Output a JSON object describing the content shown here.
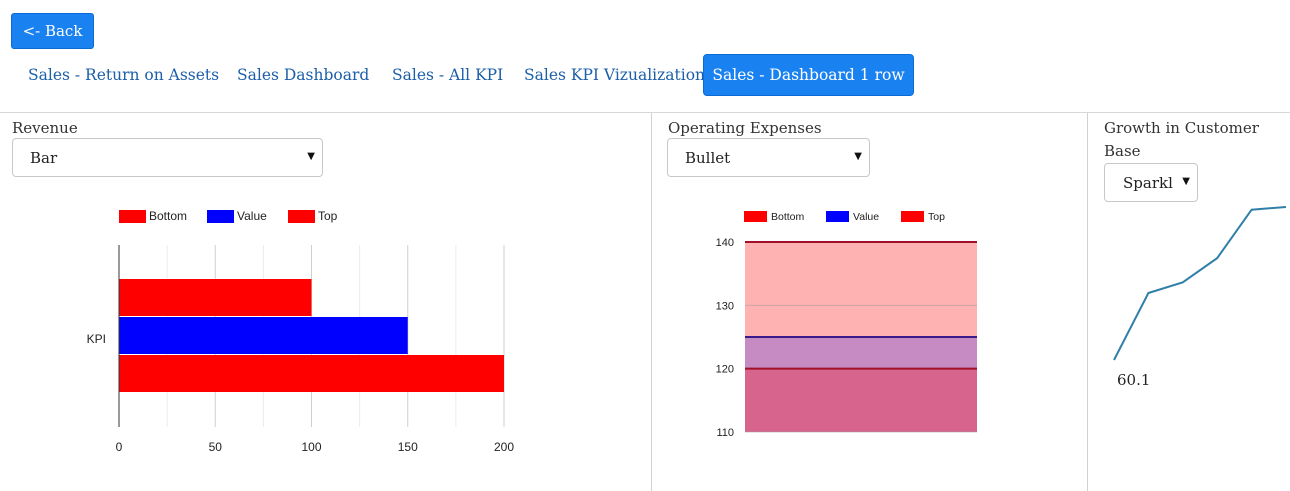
{
  "back_button": {
    "label": "<- Back"
  },
  "tabs": [
    {
      "label": "Sales - Return on Assets",
      "active": false
    },
    {
      "label": "Sales Dashboard",
      "active": false
    },
    {
      "label": "Sales - All KPI",
      "active": false
    },
    {
      "label": "Sales KPI Vizualization",
      "active": false
    },
    {
      "label": "Sales - Dashboard 1 row",
      "active": true
    }
  ],
  "panels": {
    "revenue": {
      "title": "Revenue",
      "select_value": "Bar"
    },
    "operating_expenses": {
      "title": "Operating Expenses",
      "select_value": "Bullet"
    },
    "growth": {
      "title_line1": "Growth in Customer",
      "title_line2": "Base",
      "select_value": "Sparkl",
      "value_label": "60.1"
    }
  },
  "colors": {
    "accent": "#1a82f0",
    "link": "#1c5fa8",
    "bottom": "#ff0000",
    "value": "#0000ff",
    "top": "#ff0000",
    "sparkline": "#2f7fa8"
  },
  "icons": {
    "caret": "caret-down-icon"
  },
  "chart_data": [
    {
      "type": "bar",
      "orientation": "horizontal",
      "categories": [
        "KPI"
      ],
      "series": [
        {
          "name": "Bottom",
          "values": [
            100
          ],
          "color": "#ff0000"
        },
        {
          "name": "Value",
          "values": [
            150
          ],
          "color": "#0000ff"
        },
        {
          "name": "Top",
          "values": [
            200
          ],
          "color": "#ff0000"
        }
      ],
      "xlim": [
        0,
        200
      ],
      "xticks": [
        0,
        50,
        100,
        150,
        200
      ],
      "grid": true,
      "legend": "top"
    },
    {
      "type": "bar",
      "subtype": "bullet",
      "categories": [
        ""
      ],
      "series": [
        {
          "name": "Bottom",
          "values": [
            120
          ],
          "color": "#ff0000"
        },
        {
          "name": "Value",
          "values": [
            125
          ],
          "color": "#0000ff"
        },
        {
          "name": "Top",
          "values": [
            140
          ],
          "color": "#ff0000"
        }
      ],
      "ylim": [
        110,
        140
      ],
      "yticks": [
        110,
        120,
        130,
        140
      ],
      "grid": true,
      "legend": "top"
    },
    {
      "type": "line",
      "subtype": "sparkline",
      "series": [
        {
          "values": [
            60.1,
            85,
            89,
            98,
            116,
            117
          ]
        }
      ],
      "last_label": "60.1"
    }
  ]
}
